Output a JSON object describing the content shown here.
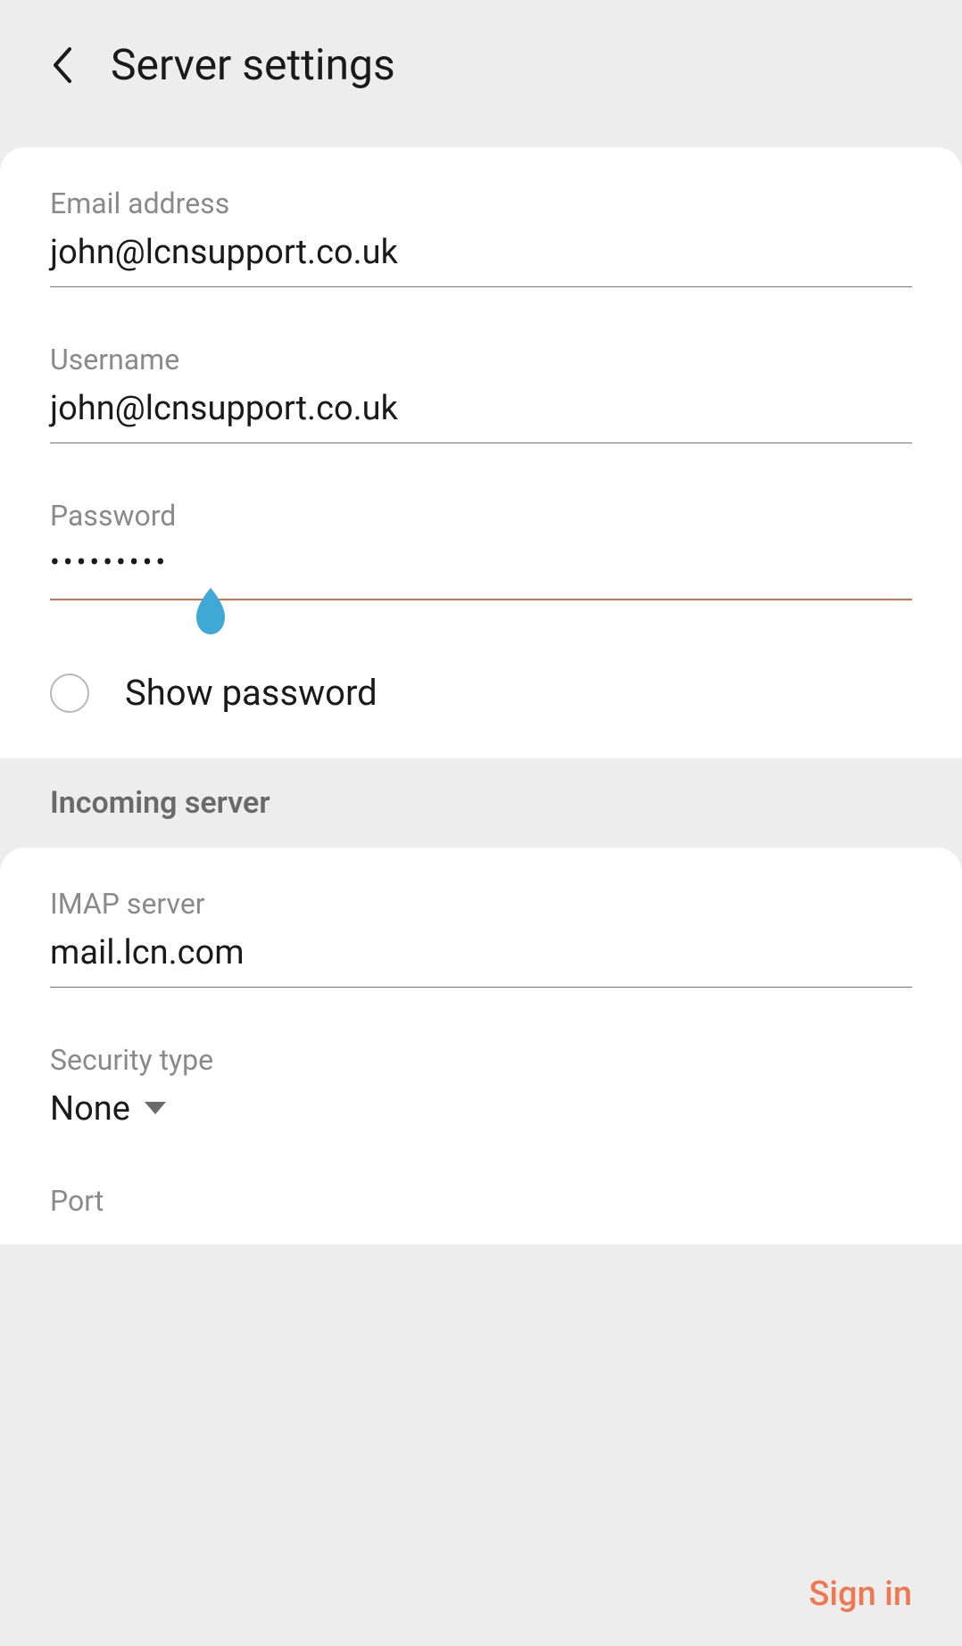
{
  "header": {
    "title": "Server settings"
  },
  "account": {
    "email_label": "Email address",
    "email_value": "john@lcnsupport.co.uk",
    "username_label": "Username",
    "username_value": "john@lcnsupport.co.uk",
    "password_label": "Password",
    "password_value": "•••••••••",
    "show_password_label": "Show password"
  },
  "incoming": {
    "section_title": "Incoming server",
    "imap_label": "IMAP server",
    "imap_value": "mail.lcn.com",
    "security_label": "Security type",
    "security_value": "None",
    "port_label": "Port"
  },
  "footer": {
    "signin_label": "Sign in"
  },
  "colors": {
    "accent": "#e07040",
    "cursor": "#3fa8d4",
    "bg": "#ededed",
    "card": "#ffffff",
    "text_primary": "#1a1a1a",
    "text_secondary": "#8a8a8a"
  }
}
